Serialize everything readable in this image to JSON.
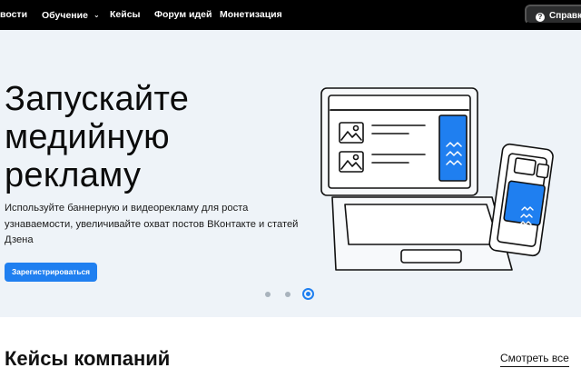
{
  "nav": {
    "items": [
      "вости",
      "Обучение",
      "Кейсы",
      "Форум идей",
      "Монетизация"
    ],
    "help_label": "Справка"
  },
  "hero": {
    "title_lines": [
      "Запускайте",
      "медийную",
      "рекламу"
    ],
    "description": "Используйте баннерную и видеорекламу для роста узнаваемости, увеличивайте охват постов ВКонтакте и статей Дзена",
    "cta_label": "Зарегистрироваться",
    "carousel": {
      "total": 3,
      "active": 3
    }
  },
  "cases": {
    "title": "Кейсы компаний",
    "see_all_label": "Смотреть все"
  },
  "colors": {
    "nav_bg": "#000000",
    "hero_bg": "#eef3f8",
    "accent": "#1f7ff0"
  }
}
